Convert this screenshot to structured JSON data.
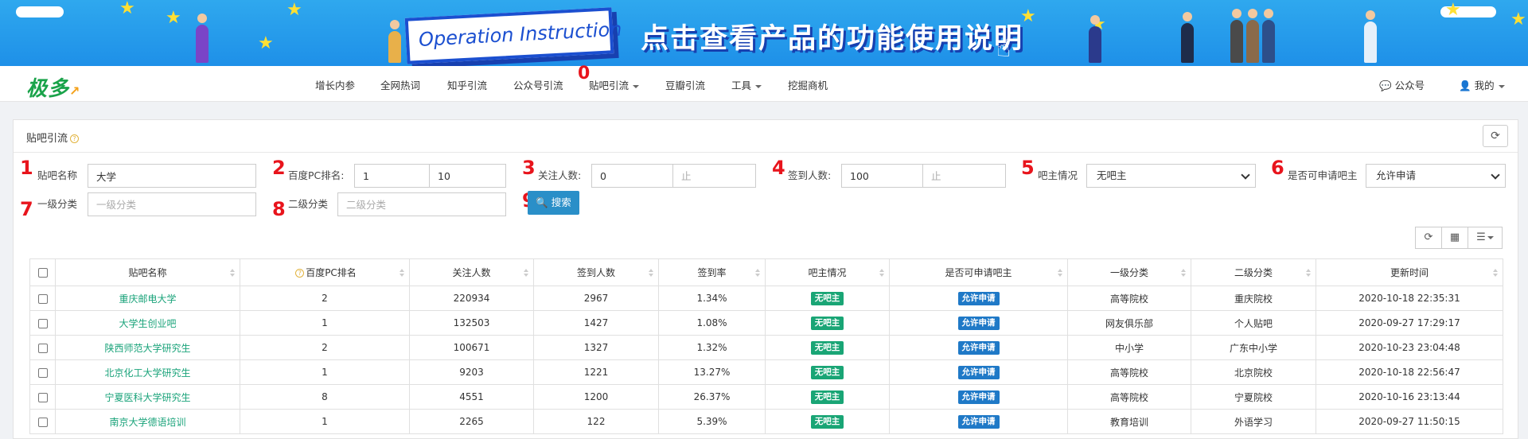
{
  "banner": {
    "en_title": "Operation Instruction",
    "cn_title": "点击查看产品的功能使用说明"
  },
  "navbar": {
    "logo": "极多",
    "items": [
      {
        "label": "增长内参"
      },
      {
        "label": "全网热词"
      },
      {
        "label": "知乎引流"
      },
      {
        "label": "公众号引流"
      },
      {
        "label": "贴吧引流"
      },
      {
        "label": "豆瓣引流"
      },
      {
        "label": "工具"
      },
      {
        "label": "挖掘商机"
      }
    ],
    "right": {
      "wechat": "公众号",
      "mine": "我的"
    }
  },
  "markers": {
    "m0": "0",
    "m1": "1",
    "m2": "2",
    "m3": "3",
    "m4": "4",
    "m5": "5",
    "m6": "6",
    "m7": "7",
    "m8": "8",
    "m9": "9"
  },
  "panel": {
    "title": "贴吧引流"
  },
  "filters": {
    "tieba_name": {
      "label": "贴吧名称",
      "value": "大学"
    },
    "baidu_rank": {
      "label": "百度PC排名:",
      "from": "1",
      "to": "10"
    },
    "followers": {
      "label": "关注人数:",
      "from": "0",
      "to_placeholder": "止"
    },
    "signins": {
      "label": "签到人数:",
      "from": "100",
      "to_placeholder": "止"
    },
    "owner_status": {
      "label": "吧主情况",
      "value": "无吧主"
    },
    "can_apply": {
      "label": "是否可申请吧主",
      "value": "允许申请"
    },
    "level1": {
      "label": "一级分类",
      "placeholder": "一级分类"
    },
    "level2": {
      "label": "二级分类",
      "placeholder": "二级分类"
    },
    "search_button": "搜索"
  },
  "table": {
    "columns": [
      "贴吧名称",
      "百度PC排名",
      "关注人数",
      "签到人数",
      "签到率",
      "吧主情况",
      "是否可申请吧主",
      "一级分类",
      "二级分类",
      "更新时间"
    ],
    "rows": [
      [
        "重庆邮电大学",
        "2",
        "220934",
        "2967",
        "1.34%",
        "无吧主",
        "允许申请",
        "高等院校",
        "重庆院校",
        "2020-10-18 22:35:31"
      ],
      [
        "大学生创业吧",
        "1",
        "132503",
        "1427",
        "1.08%",
        "无吧主",
        "允许申请",
        "网友俱乐部",
        "个人贴吧",
        "2020-09-27 17:29:17"
      ],
      [
        "陕西师范大学研究生",
        "2",
        "100671",
        "1327",
        "1.32%",
        "无吧主",
        "允许申请",
        "中小学",
        "广东中小学",
        "2020-10-23 23:04:48"
      ],
      [
        "北京化工大学研究生",
        "1",
        "9203",
        "1221",
        "13.27%",
        "无吧主",
        "允许申请",
        "高等院校",
        "北京院校",
        "2020-10-18 22:56:47"
      ],
      [
        "宁夏医科大学研究生",
        "8",
        "4551",
        "1200",
        "26.37%",
        "无吧主",
        "允许申请",
        "高等院校",
        "宁夏院校",
        "2020-10-16 23:13:44"
      ],
      [
        "南京大学德语培训",
        "1",
        "2265",
        "122",
        "5.39%",
        "无吧主",
        "允许申请",
        "教育培训",
        "外语学习",
        "2020-09-27 11:50:15"
      ]
    ]
  }
}
